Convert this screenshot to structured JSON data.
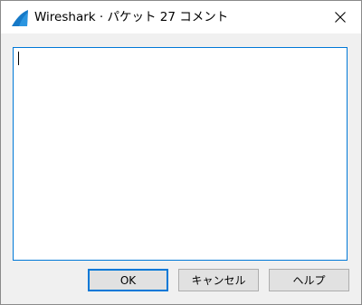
{
  "window": {
    "title": "Wireshark · パケット 27 コメント",
    "app_icon": "wireshark-fin-icon",
    "close_icon": "close-icon"
  },
  "comment": {
    "value": ""
  },
  "buttons": {
    "ok_label": "OK",
    "cancel_label": "キャンセル",
    "help_label": "ヘルプ"
  },
  "colors": {
    "accent": "#0078d7",
    "icon_blue": "#1679c7"
  }
}
